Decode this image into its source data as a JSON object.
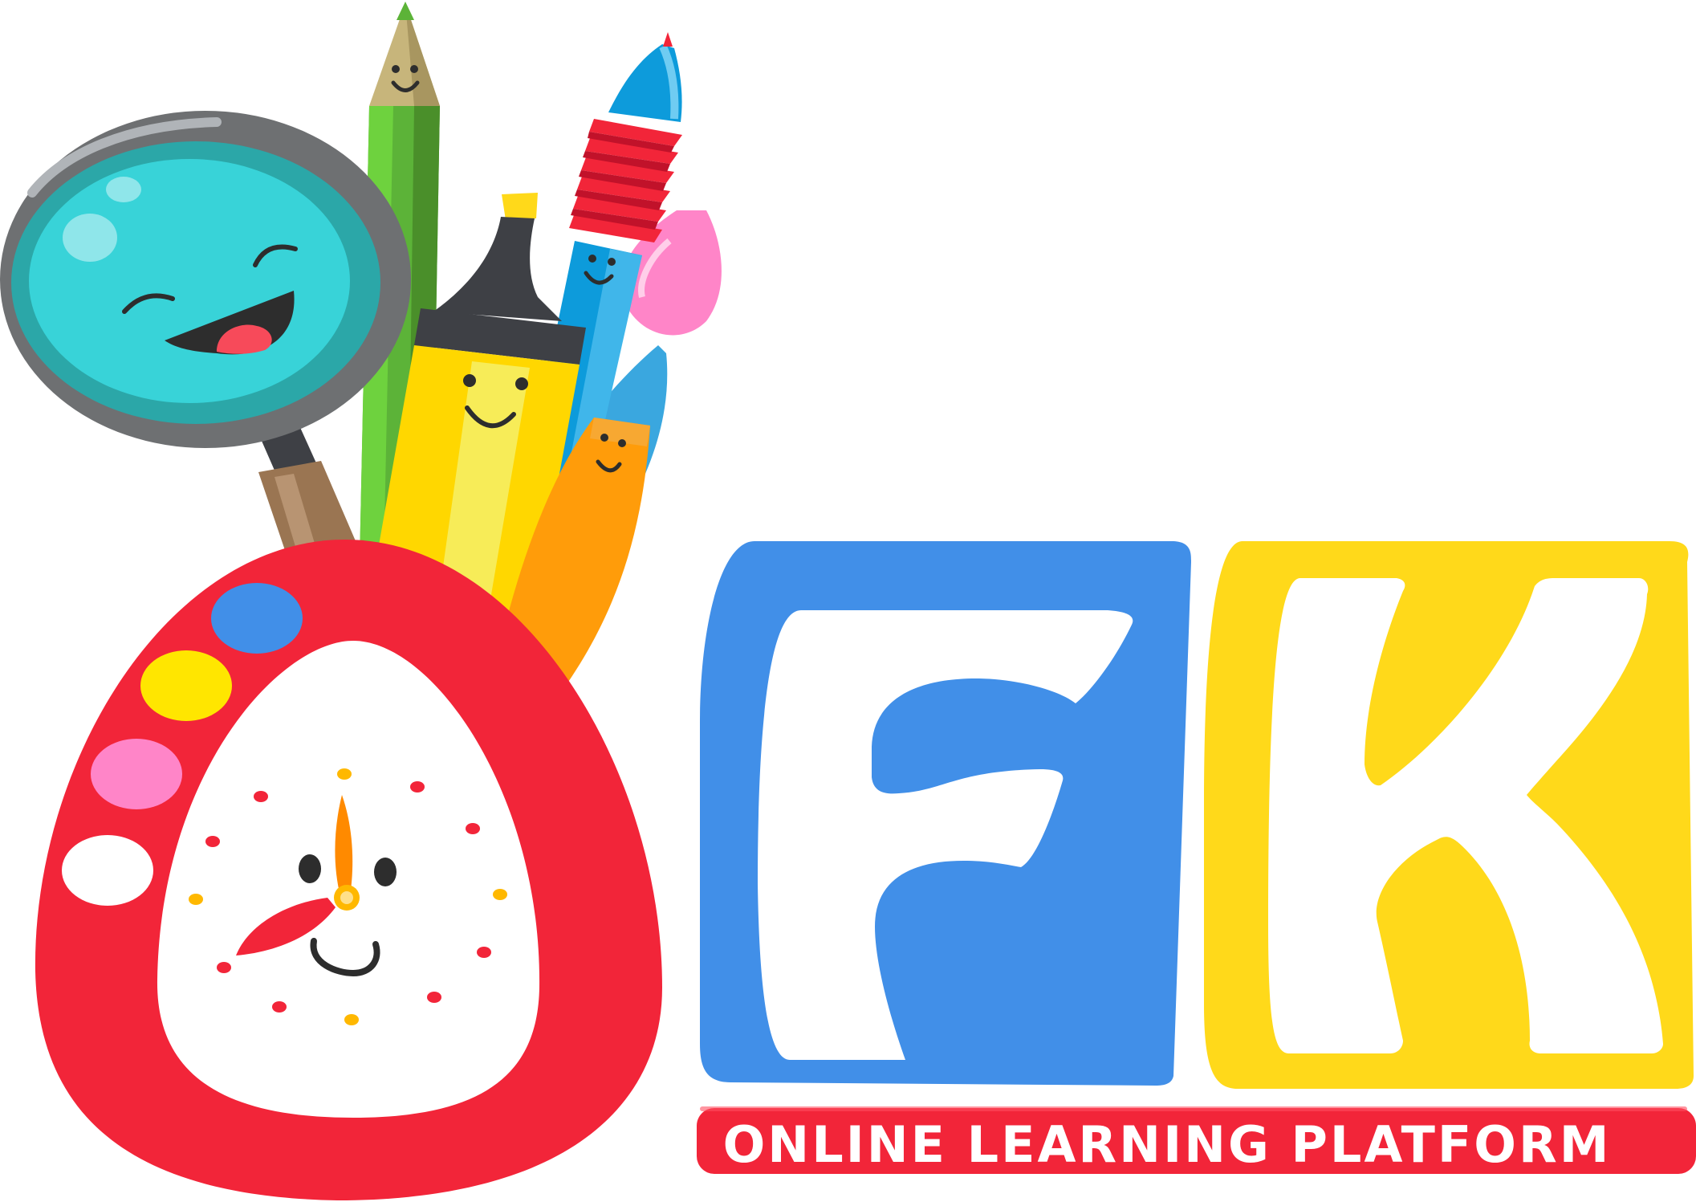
{
  "brand": {
    "letters": [
      "F",
      "K"
    ],
    "tagline": "ONLINE LEARNING PLATFORM",
    "colors": {
      "red": "#F22539",
      "blue": "#418FE8",
      "yellow": "#FFD91A",
      "teal": "#38D3D8",
      "green": "#5CB338",
      "orange": "#FF9C0A",
      "pink": "#FF85C8",
      "grey": "#6E7072",
      "white": "#FFFFFF"
    }
  },
  "illustration": {
    "icons": [
      "magnifying-glass-icon",
      "pencil-icon",
      "highlighter-icon",
      "pen-icon",
      "paintbrush-icon",
      "alarm-clock-icon"
    ]
  }
}
